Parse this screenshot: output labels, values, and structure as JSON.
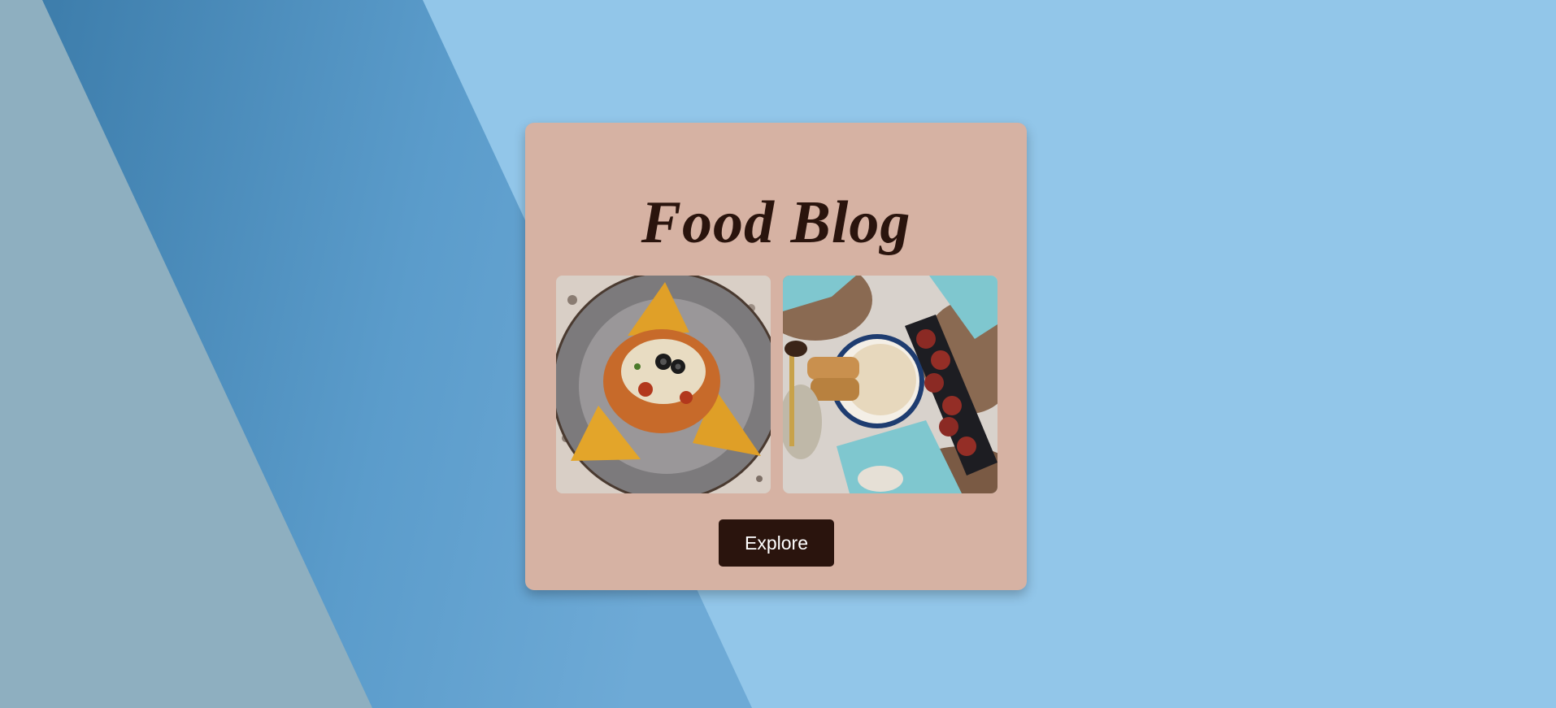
{
  "card": {
    "title": "Food Blog",
    "explore_label": "Explore"
  },
  "photos": [
    {
      "icon": "nachos-plate-photo"
    },
    {
      "icon": "pasta-and-wings-table-photo"
    }
  ],
  "colors": {
    "page_background": "#8fc5e8",
    "card_background": "#d6b2a3",
    "title_text": "#2a140d",
    "button_background": "#2a140d",
    "button_text": "#ffffff"
  }
}
